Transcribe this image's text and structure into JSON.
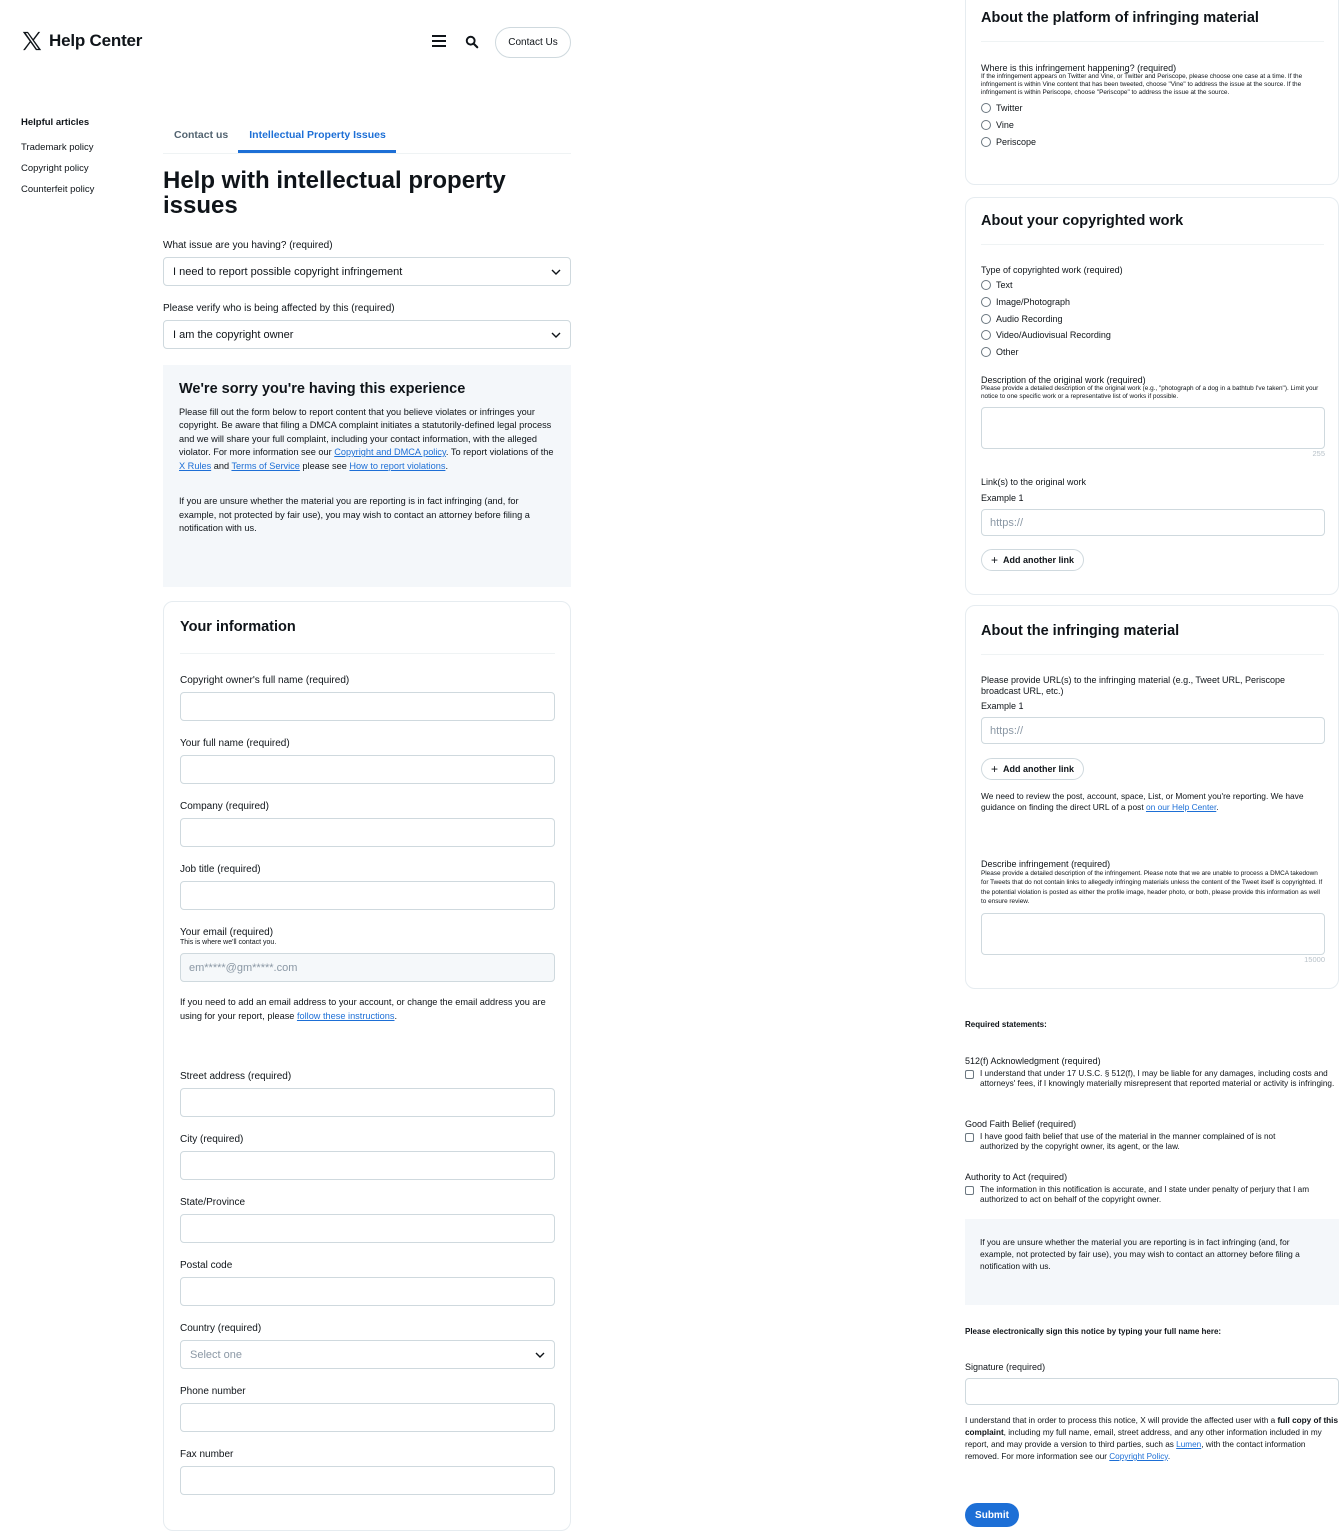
{
  "header": {
    "logo_text": "Help Center",
    "contact_button": "Contact Us"
  },
  "sidebar": {
    "title": "Helpful articles",
    "items": [
      {
        "label": "Trademark policy"
      },
      {
        "label": "Copyright policy"
      },
      {
        "label": "Counterfeit policy"
      }
    ]
  },
  "tabs": [
    {
      "label": "Contact us",
      "active": false
    },
    {
      "label": "Intellectual Property Issues",
      "active": true
    }
  ],
  "page_title": "Help with intellectual property issues",
  "issue_select": {
    "label": "What issue are you having?",
    "required": "(required)",
    "value": "I need to report possible copyright infringement"
  },
  "affected_select": {
    "label": "Please verify who is being affected by this",
    "required": "(required)",
    "value": "I am the copyright owner"
  },
  "notice": {
    "title": "We're sorry you're having this experience",
    "p1_a": "Please fill out the form below to report content that you believe violates or infringes your copyright. Be aware that filing a DMCA complaint initiates a statutorily-defined legal process and we will share your full complaint, including your contact information, with the alleged violator. For more information see our ",
    "p1_link1": "Copyright and DMCA policy",
    "p1_b": ". To report violations of the ",
    "p1_link2": "X Rules",
    "p1_c": " and ",
    "p1_link3": "Terms of Service",
    "p1_d": " please see ",
    "p1_link4": "How to report violations",
    "p1_e": ".",
    "p2": "If you are unsure whether the material you are reporting is in fact infringing (and, for example, not protected by fair use), you may wish to contact an attorney before filing a notification with us."
  },
  "your_info": {
    "title": "Your information",
    "owner_name": {
      "label": "Copyright owner's full name",
      "required": "(required)"
    },
    "full_name": {
      "label": "Your full name",
      "required": "(required)"
    },
    "company": {
      "label": "Company",
      "required": "(required)"
    },
    "job_title": {
      "label": "Job title",
      "required": "(required)"
    },
    "email": {
      "label": "Your email",
      "required": "(required)",
      "help": "This is where we'll contact you.",
      "value": "em*****@gm*****.com"
    },
    "email_note_a": "If you need to add an email address to your account, or change the email address you are using for your report, please ",
    "email_note_link": "follow these instructions",
    "email_note_b": ".",
    "street": {
      "label": "Street address",
      "required": "(required)"
    },
    "city": {
      "label": "City",
      "required": "(required)"
    },
    "state": {
      "label": "State/Province"
    },
    "postal": {
      "label": "Postal code"
    },
    "country": {
      "label": "Country",
      "required": "(required)",
      "placeholder": "Select one"
    },
    "phone": {
      "label": "Phone number"
    },
    "fax": {
      "label": "Fax number"
    }
  },
  "platform": {
    "title": "About the platform of infringing material",
    "label": "Where is this infringement happening?",
    "required": "(required)",
    "help": "If the infringement appears on Twitter and Vine, or Twitter and Periscope, please choose one case at a time. If the infringement is within Vine content that has been tweeted, choose \"Vine\" to address the issue at the source. If the infringement is within Periscope, choose \"Periscope\" to address the issue at the source.",
    "options": [
      "Twitter",
      "Vine",
      "Periscope"
    ]
  },
  "work": {
    "title": "About your copyrighted work",
    "type_label": "Type of copyrighted work",
    "type_required": "(required)",
    "types": [
      "Text",
      "Image/Photograph",
      "Audio Recording",
      "Video/Audiovisual Recording",
      "Other"
    ],
    "desc_label": "Description of the original work",
    "desc_required": "(required)",
    "desc_help": "Please provide a detailed description of the original work (e.g., \"photograph of a dog in a bathtub I've taken\"). Limit your notice to one specific work or a representative list of works if possible.",
    "desc_counter": "255",
    "links_label": "Link(s) to the original work",
    "example": "Example 1",
    "url_placeholder": "https://",
    "add_link": "Add another link"
  },
  "infringing": {
    "title": "About the infringing material",
    "urls_label": "Please provide URL(s) to the infringing material (e.g., Tweet URL, Periscope broadcast URL, etc.)",
    "example": "Example 1",
    "url_placeholder": "https://",
    "add_link": "Add another link",
    "review_a": "We need to review the post, account, space, List, or Moment you're reporting. We have guidance on finding the direct URL of a post ",
    "review_link": "on our Help Center",
    "review_b": ".",
    "describe_label": "Describe infringement",
    "describe_required": "(required)",
    "describe_help": "Please provide a detailed description of the infringement. Please note that we are unable to process a DMCA takedown for Tweets that do not contain links to allegedly infringing materials unless the content of the Tweet itself is copyrighted. If the potential violation is posted as either the profile image, header photo, or both, please provide this information as well to ensure review.",
    "describe_counter": "15000"
  },
  "statements": {
    "title": "Required statements:",
    "ack_label": "512(f) Acknowledgment",
    "ack_required": "(required)",
    "ack_text": "I understand that under 17 U.S.C. § 512(f), I may be liable for any damages, including costs and attorneys' fees, if I knowingly materially misrepresent that reported material or activity is infringing.",
    "good_label": "Good Faith Belief",
    "good_required": "(required)",
    "good_text": "I have good faith belief that use of the material in the manner complained of is not authorized by the copyright owner, its agent, or the law.",
    "auth_label": "Authority to Act",
    "auth_required": "(required)",
    "auth_text": "The information in this notification is accurate, and I state under penalty of perjury that I am authorized to act on behalf of the copyright owner.",
    "unsure": "If you are unsure whether the material you are reporting is in fact infringing (and, for example, not protected by fair use), you may wish to contact an attorney before filing a notification with us."
  },
  "signature": {
    "prompt": "Please electronically sign this notice by typing your full name here:",
    "label": "Signature",
    "required": "(required)",
    "note_a": "I understand that in order to process this notice, X will provide the affected user with a ",
    "note_bold": "full copy of this complaint",
    "note_b": ", including my full name, email, street address, and any other information included in my report, and may provide a version to third parties, such as ",
    "note_link1": "Lumen",
    "note_c": ", with the contact information removed. For more information see our ",
    "note_link2": "Copyright Policy",
    "note_d": "."
  },
  "submit": "Submit"
}
